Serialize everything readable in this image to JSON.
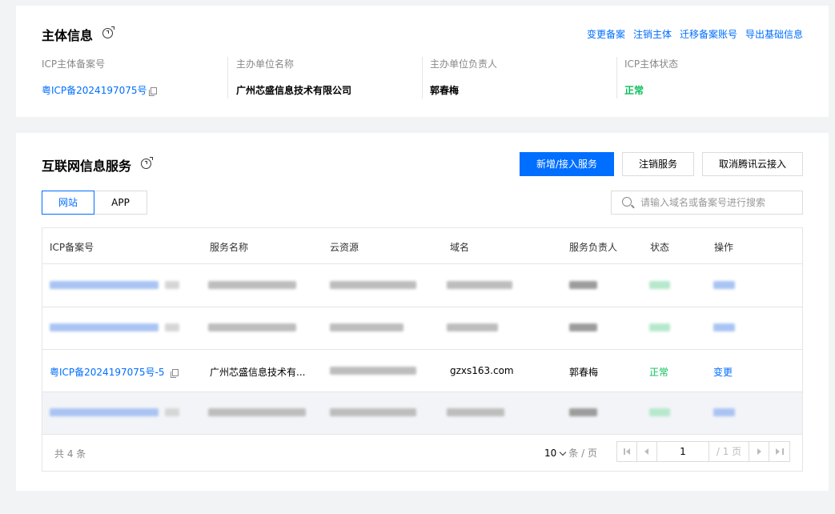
{
  "entity_section": {
    "title": "主体信息",
    "links": [
      "变更备案",
      "注销主体",
      "迁移备案账号",
      "导出基础信息"
    ],
    "fields": [
      {
        "label": "ICP主体备案号",
        "value": "粤ICP备2024197075号"
      },
      {
        "label": "主办单位名称",
        "value": "广州芯盛信息技术有限公司"
      },
      {
        "label": "主办单位负责人",
        "value": "郭春梅"
      },
      {
        "label": "ICP主体状态",
        "value": "正常"
      }
    ]
  },
  "service_section": {
    "title": "互联网信息服务",
    "buttons": {
      "add": "新增/接入服务",
      "cancel": "注销服务",
      "cancel_access": "取消腾讯云接入"
    },
    "tabs": [
      "网站",
      "APP"
    ],
    "search_placeholder": "请输入域名或备案号进行搜索",
    "table": {
      "headers": [
        "ICP备案号",
        "服务名称",
        "云资源",
        "域名",
        "服务负责人",
        "状态",
        "操作"
      ],
      "visible_row": {
        "icp": "粤ICP备2024197075号-5",
        "service_name": "广州芯盛信息技术有...",
        "domain": "gzxs163.com",
        "owner": "郭春梅",
        "status": "正常",
        "action": "变更"
      }
    },
    "footer": {
      "total": "共 4 条",
      "page_size": "10",
      "page_size_unit": "条 / 页",
      "current_page": "1",
      "total_pages": "/ 1 页"
    }
  },
  "colors": {
    "accent": "#006eff",
    "success": "#0abf5b",
    "background": "#f2f3f5"
  }
}
